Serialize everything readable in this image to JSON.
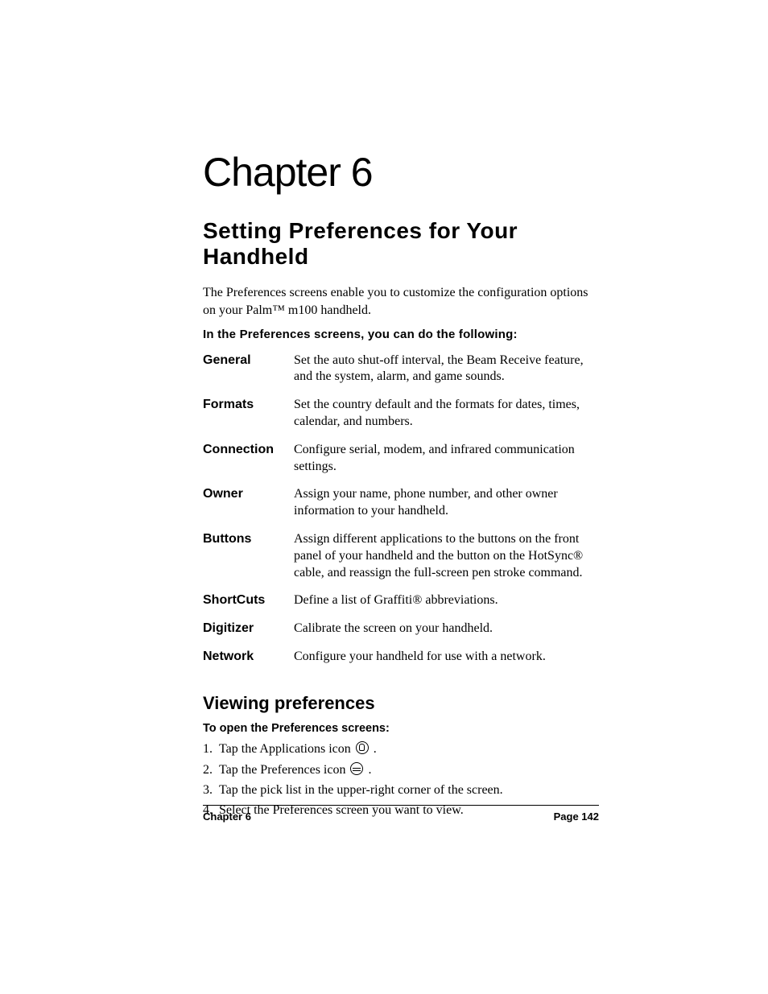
{
  "chapter_title": "Chapter 6",
  "section_title": "Setting Preferences for Your Handheld",
  "intro": "The Preferences screens enable you to customize the configuration options on your Palm™ m100 handheld.",
  "sub_heading": "In the Preferences screens, you can do the following:",
  "prefs": [
    {
      "term": "General",
      "desc": "Set the auto shut-off interval, the Beam Receive feature, and the system, alarm, and game sounds."
    },
    {
      "term": "Formats",
      "desc": "Set the country default and the formats for dates, times, calendar, and numbers."
    },
    {
      "term": "Connection",
      "desc": "Configure serial, modem, and infrared communication settings."
    },
    {
      "term": "Owner",
      "desc": "Assign your name, phone number, and other owner information to your handheld."
    },
    {
      "term": "Buttons",
      "desc": "Assign different applications to the buttons on the front panel of your handheld and the button on the HotSync® cable, and reassign the full-screen pen stroke command."
    },
    {
      "term": "ShortCuts",
      "desc": "Define a list of Graffiti® abbreviations."
    },
    {
      "term": "Digitizer",
      "desc": "Calibrate the screen on your handheld."
    },
    {
      "term": "Network",
      "desc": "Configure your handheld for use with a network."
    }
  ],
  "subsection_title": "Viewing preferences",
  "steps_heading": "To open the Preferences screens:",
  "steps": {
    "s1_pre": "Tap the Applications icon ",
    "s1_post": " .",
    "s2_pre": "Tap the Preferences icon ",
    "s2_post": " .",
    "s3": "Tap the pick list in the upper-right corner of the screen.",
    "s4": "Select the Preferences screen you want to view."
  },
  "footer": {
    "left": "Chapter 6",
    "right": "Page 142"
  }
}
